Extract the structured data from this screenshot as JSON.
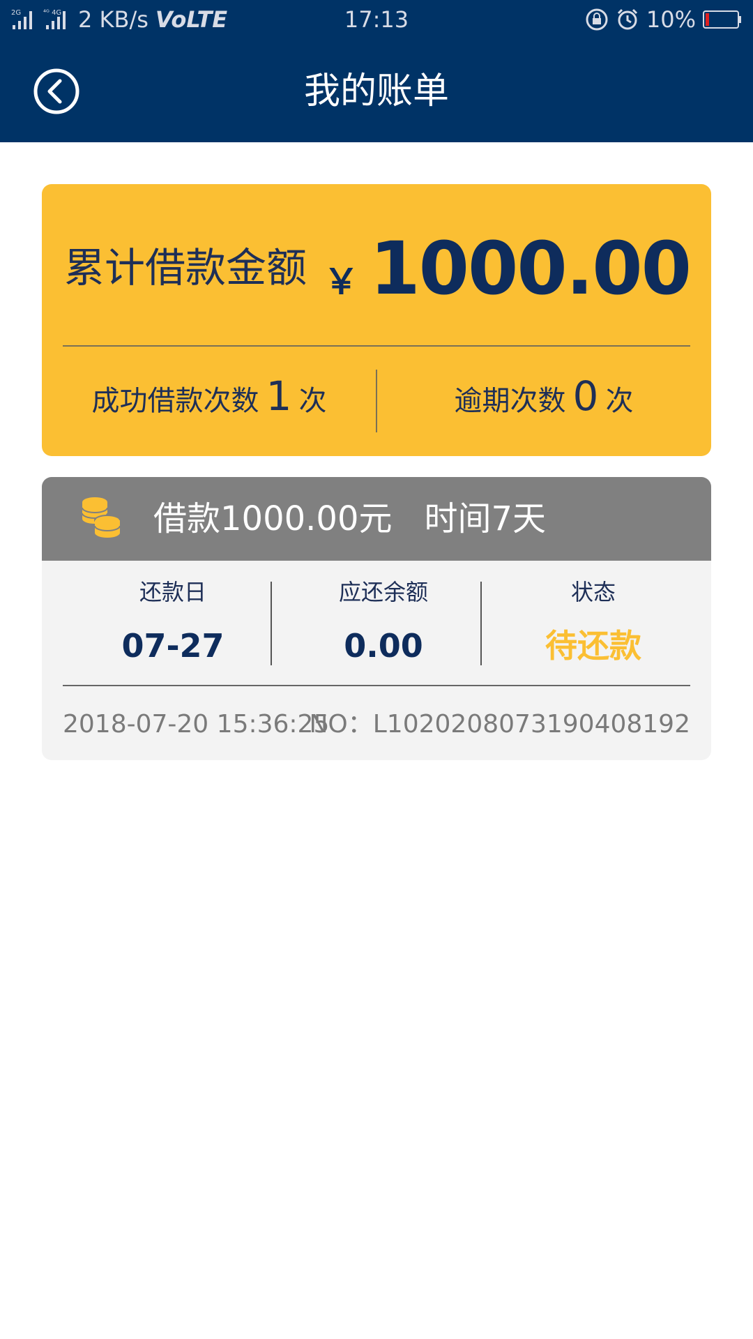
{
  "status_bar": {
    "net_2g": "2G",
    "net_4g": "4G",
    "speed": "2 KB/s",
    "volte": "VoLTE",
    "time": "17:13",
    "battery": "10%",
    "icons": [
      "signal-icon",
      "signal-icon",
      "lock-rotation-icon",
      "alarm-icon",
      "battery-icon"
    ]
  },
  "header": {
    "title": "我的账单",
    "back_icon": "back-arrow-icon"
  },
  "summary": {
    "total_label": "累计借款金额",
    "currency": "￥",
    "total_amount": "1000.00",
    "success_label": "成功借款次数",
    "success_count": "1",
    "success_unit": "次",
    "overdue_label": "逾期次数",
    "overdue_count": "0",
    "overdue_unit": "次"
  },
  "loan": {
    "icon": "coins-icon",
    "title_amount": "借款1000.00元",
    "title_duration": "时间7天",
    "columns": [
      {
        "label": "还款日",
        "value": "07-27"
      },
      {
        "label": "应还余额",
        "value": "0.00"
      },
      {
        "label": "状态",
        "value": "待还款"
      }
    ],
    "datetime": "2018-07-20 15:36:25",
    "order_no": "NO：L102020807319040819​2"
  },
  "colors": {
    "header_bg": "#003366",
    "card_yellow": "#fbbf33",
    "text_navy": "#0e2c5c",
    "loan_head_gray": "#808080",
    "loan_body_bg": "#f3f3f3",
    "status_pending": "#fbbf33"
  }
}
